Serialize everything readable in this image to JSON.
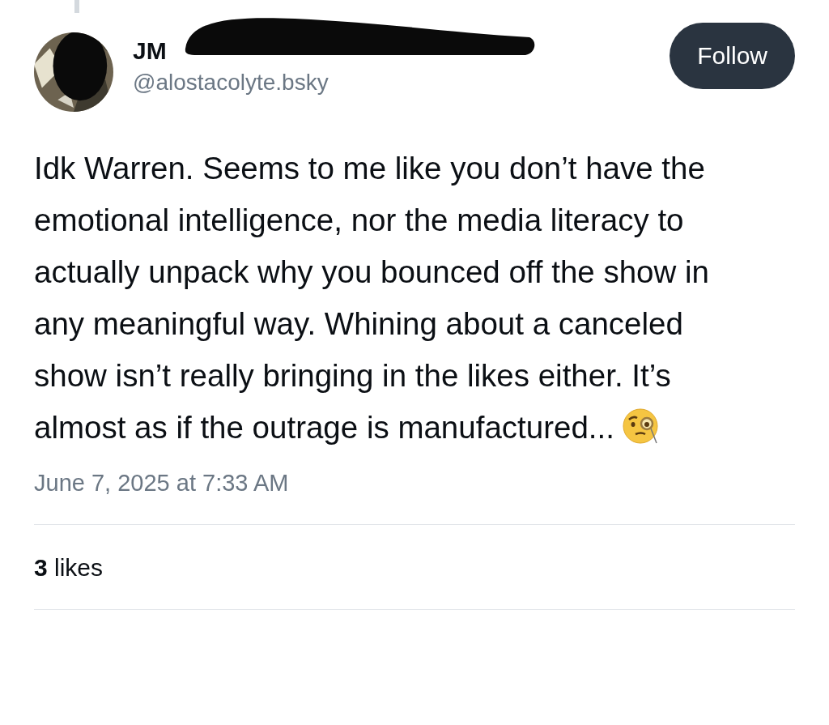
{
  "author": {
    "name": "JM",
    "handle": "@alostacolyte.bsky"
  },
  "follow_button": {
    "label": "Follow"
  },
  "post": {
    "text": "Idk Warren. Seems to me like you don’t have the emotional intelligence, nor the media literacy to actually unpack why you bounced off the show in any meaningful way. Whining about a canceled show isn’t really bringing in the likes either. It’s almost as if the outrage is manufactured...",
    "timestamp": "June 7, 2025 at 7:33 AM"
  },
  "stats": {
    "likes": "**3** likes"
  }
}
